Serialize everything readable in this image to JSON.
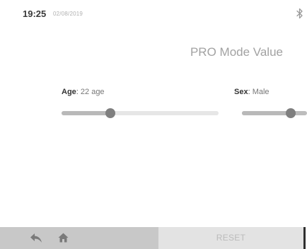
{
  "status": {
    "time": "19:25",
    "date": "02/08/2019",
    "bluetooth_icon": "bluetooth-icon"
  },
  "page": {
    "title": "PRO Mode Value"
  },
  "params": {
    "age": {
      "label": "Age",
      "value": "22 age",
      "level_fraction": 0.31
    },
    "sex": {
      "label": "Sex",
      "value": "Male",
      "level_fraction": 0.75
    }
  },
  "bottom_bar": {
    "back_icon": "back-arrow-icon",
    "home_icon": "home-icon",
    "reset_label": "RESET"
  },
  "colors": {
    "thumb": "#7f7f7f",
    "nav_background": "#c8c8c8",
    "reset_background": "#e3e3e3"
  }
}
